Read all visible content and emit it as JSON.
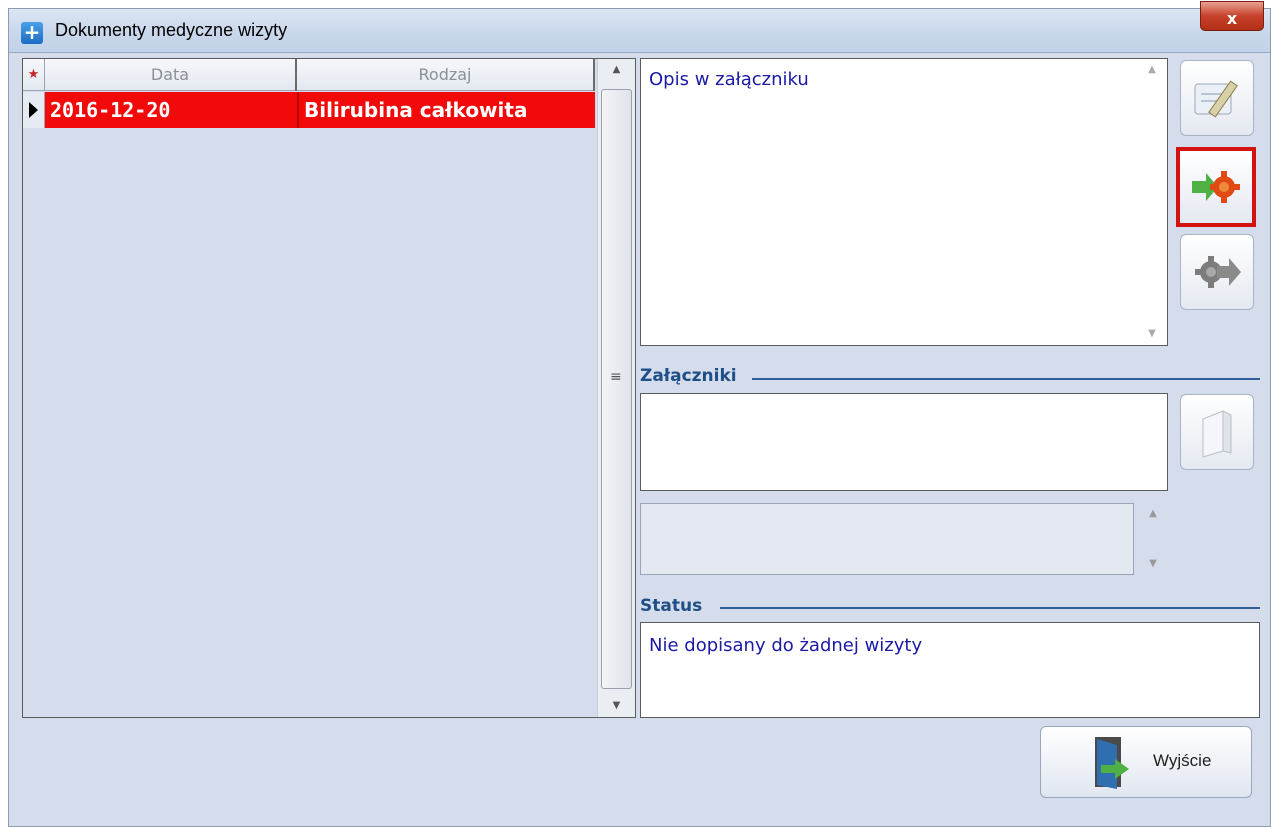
{
  "window": {
    "title": "Dokumenty medyczne wizyty",
    "close_label": "x"
  },
  "grid": {
    "star_marker": "★",
    "columns": [
      "Data",
      "Rodzaj"
    ],
    "rows": [
      {
        "date": "2016-12-20",
        "type": "Bilirubina całkowita",
        "selected": true
      }
    ],
    "scroll_grip": "≡"
  },
  "description": {
    "text": "Opis w załączniku"
  },
  "sections": {
    "attachments": "Załączniki",
    "status": "Status"
  },
  "status": {
    "text": "Nie dopisany do żadnej wizyty"
  },
  "buttons": {
    "exit": "Wyjście"
  },
  "icons": {
    "app": "plus-icon",
    "edit": "edit-document-icon",
    "pin": "attach-visit-icon",
    "unpin": "detach-visit-icon",
    "attach": "attachment-icon",
    "exit": "exit-door-icon"
  },
  "colors": {
    "selected_row": "#f20a0a",
    "text_blue": "#1a1aa6",
    "section_label": "#1f4f87",
    "highlight_frame": "#d41212"
  }
}
